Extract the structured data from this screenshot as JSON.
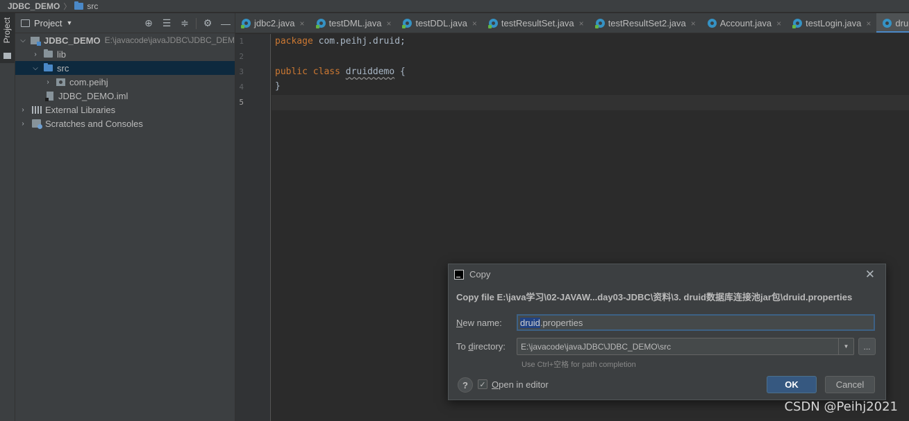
{
  "breadcrumb": {
    "project": "JDBC_DEMO",
    "folder": "src"
  },
  "left_strip": {
    "tab_label": "Project"
  },
  "project_panel": {
    "title": "Project",
    "tree": {
      "root_label": "JDBC_DEMO",
      "root_path": "E:\\javacode\\javaJDBC\\JDBC_DEM",
      "lib": "lib",
      "src": "src",
      "package": "com.peihj",
      "iml": "JDBC_DEMO.iml",
      "external_libraries": "External Libraries",
      "scratches": "Scratches and Consoles"
    }
  },
  "tabs": [
    {
      "label": "jdbc2.java"
    },
    {
      "label": "testDML.java"
    },
    {
      "label": "testDDL.java"
    },
    {
      "label": "testResultSet.java"
    },
    {
      "label": "testResultSet2.java"
    },
    {
      "label": "Account.java"
    },
    {
      "label": "testLogin.java"
    },
    {
      "label": "druid"
    }
  ],
  "editor": {
    "line_numbers": [
      "1",
      "2",
      "3",
      "4",
      "5"
    ],
    "line1_kw": "package",
    "line1_rest": " com.peihj.druid;",
    "line3_kw": "public class",
    "line3_cls": "druiddemo",
    "line3_rest": " {",
    "line4": "}"
  },
  "dialog": {
    "title": "Copy",
    "message": "Copy file E:\\java学习\\02-JAVAW...day03-JDBC\\资料\\3. druid数据库连接池jar包\\druid.properties",
    "new_name_label_u": "N",
    "new_name_label_rest": "ew name:",
    "new_name_selected": "druid",
    "new_name_rest": ".properties",
    "to_dir_label_a": "To ",
    "to_dir_label_u": "d",
    "to_dir_label_b": "irectory:",
    "to_dir_value": "E:\\javacode\\javaJDBC\\JDBC_DEMO\\src",
    "browse_label": "...",
    "hint": "Use Ctrl+空格 for path completion",
    "help_label": "?",
    "open_in_editor_u": "O",
    "open_in_editor_rest": "pen in editor",
    "open_in_editor_checked": true,
    "ok_label": "OK",
    "cancel_label": "Cancel"
  },
  "watermark": "CSDN @Peihj2021",
  "colors": {
    "accent": "#4a88c7",
    "ok_button": "#365880",
    "selection": "#214283",
    "keyword": "#cc7832"
  }
}
